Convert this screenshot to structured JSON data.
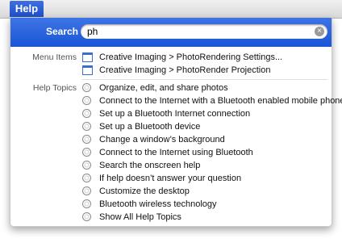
{
  "menubar": {
    "help_label": "Help"
  },
  "search": {
    "label": "Search",
    "value": "ph"
  },
  "menu_items_section": {
    "label": "Menu Items",
    "items": [
      "Creative Imaging > PhotoRendering Settings...",
      "Creative Imaging > PhotoRender Projection"
    ]
  },
  "help_topics_section": {
    "label": "Help Topics",
    "items": [
      "Organize, edit, and share photos",
      "Connect to the Internet with a Bluetooth enabled mobile phone",
      "Set up a Bluetooth Internet connection",
      "Set up a Bluetooth device",
      "Change a window’s background",
      "Connect to the Internet using Bluetooth",
      "Search the onscreen help",
      "If help doesn’t answer your question",
      "Customize the desktop",
      "Bluetooth wireless technology"
    ]
  },
  "show_all": {
    "label": "Show All Help Topics"
  },
  "icons": {
    "menu_item": "window-icon",
    "help_topic": "help-lifebuoy-icon",
    "clear": "clear-search-icon"
  },
  "colors": {
    "accent": "#1f55d6",
    "menu_highlight": "#2f5fd8"
  }
}
